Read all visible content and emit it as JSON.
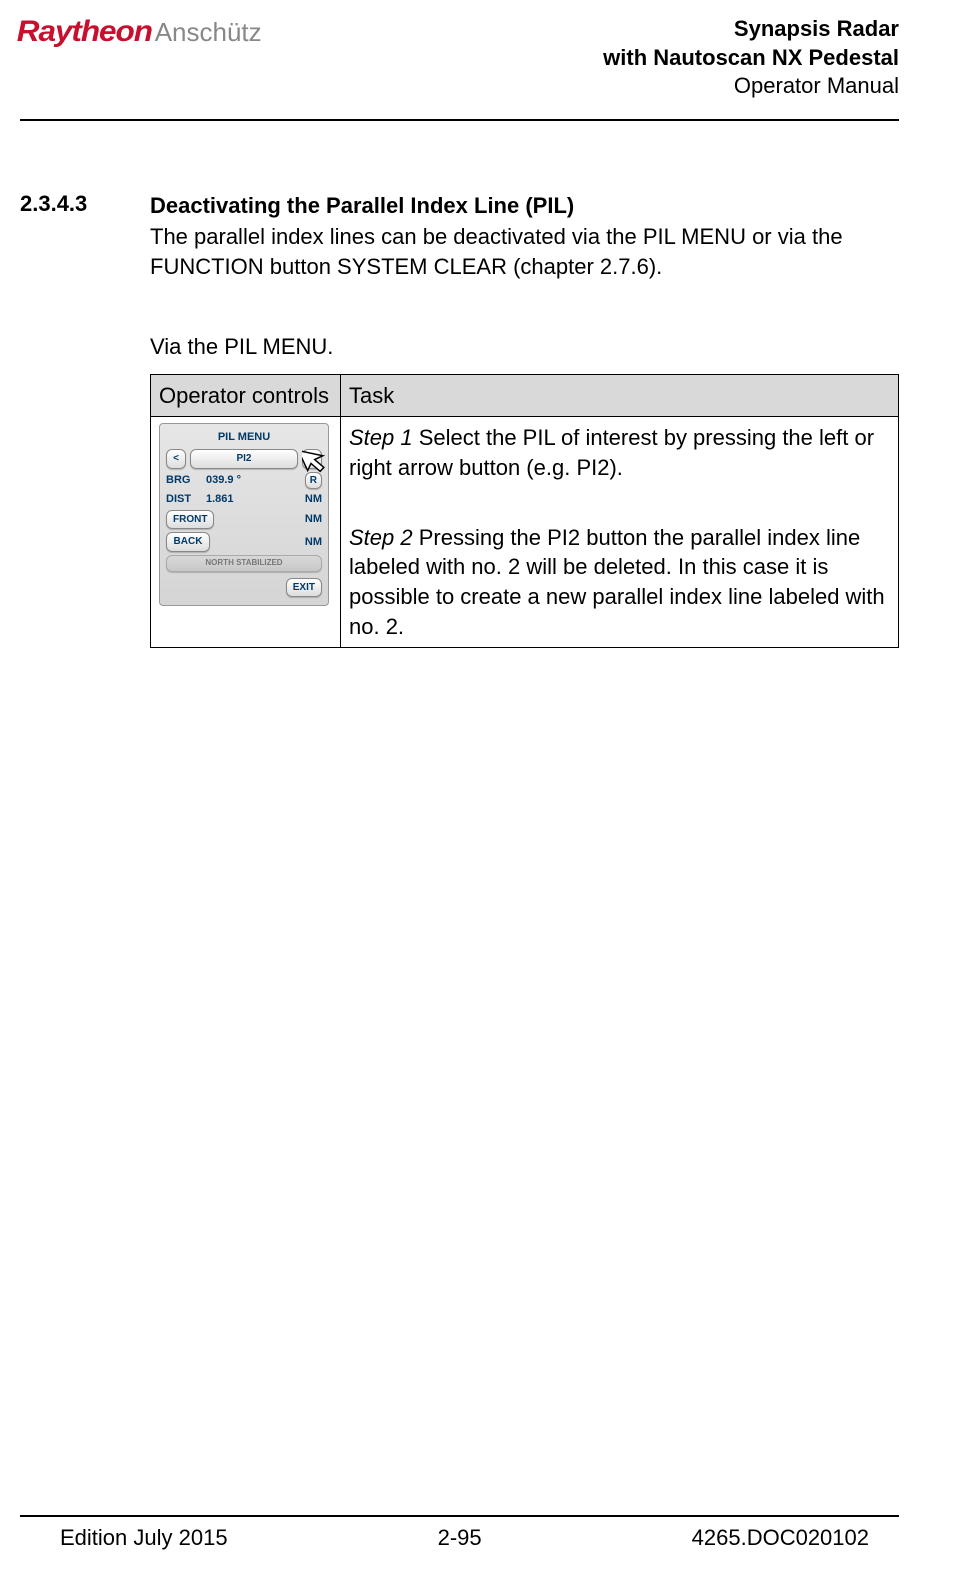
{
  "header": {
    "logo_brand": "Raytheon",
    "logo_sub": "Anschütz",
    "title_line1": "Synapsis Radar",
    "title_line2": "with Nautoscan NX Pedestal",
    "title_line3": "Operator Manual"
  },
  "section": {
    "number": "2.3.4.3",
    "title": "Deactivating the Parallel Index Line (PIL)",
    "intro": "The parallel index lines can be deactivated via the PIL MENU or via the FUNCTION button SYSTEM CLEAR (chapter 2.7.6).",
    "subhead": "Via the PIL MENU."
  },
  "table": {
    "headers": {
      "col1": "Operator controls",
      "col2": "Task"
    },
    "step1_label": "Step 1",
    "step1_text": " Select the PIL of interest by pressing the left or right arrow button (e.g. PI2).",
    "step2_label": "Step 2",
    "step2_text": " Pressing the PI2 button the parallel index line labeled with no. 2 will be deleted. In this case it is possible to create a new parallel index line labeled with no. 2."
  },
  "pil_menu": {
    "title": "PIL MENU",
    "left_arrow": "<",
    "pi_button": "PI2",
    "right_arrow": ">",
    "brg_label": "BRG",
    "brg_value": "039.9 °",
    "brg_mode": "R",
    "dist_label": "DIST",
    "dist_value": "1.861",
    "dist_unit": "NM",
    "front_label": "FRONT",
    "front_unit": "NM",
    "back_label": "BACK",
    "back_unit": "NM",
    "north_stab": "NORTH STABILIZED",
    "exit": "EXIT"
  },
  "footer": {
    "left": "Edition July 2015",
    "center": "2-95",
    "right": "4265.DOC020102"
  }
}
